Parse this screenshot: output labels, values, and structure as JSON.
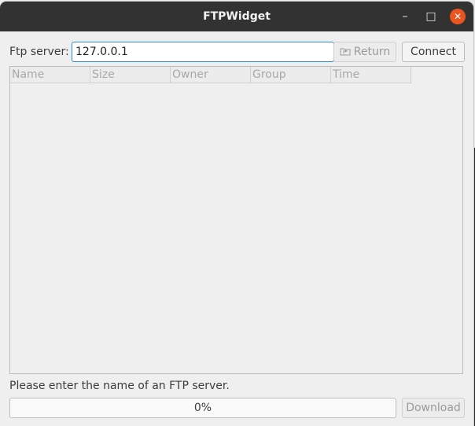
{
  "window": {
    "title": "FTPWidget"
  },
  "titlebar": {
    "minimize": "–",
    "maximize": "□",
    "close": "✕"
  },
  "server": {
    "label": "Ftp server:",
    "value": "127.0.0.1"
  },
  "toolbar": {
    "return_label": "Return",
    "connect_label": "Connect"
  },
  "columns": [
    "Name",
    "Size",
    "Owner",
    "Group",
    "Time"
  ],
  "status": {
    "message": "Please enter the name of an FTP server."
  },
  "progress": {
    "value": "0%",
    "fraction": 0
  },
  "download_label": "Download",
  "colors": {
    "titlebar": "#323232",
    "close": "#e95420",
    "focus": "#2d8ad6"
  },
  "icons": {
    "return": "folder-up-icon"
  }
}
